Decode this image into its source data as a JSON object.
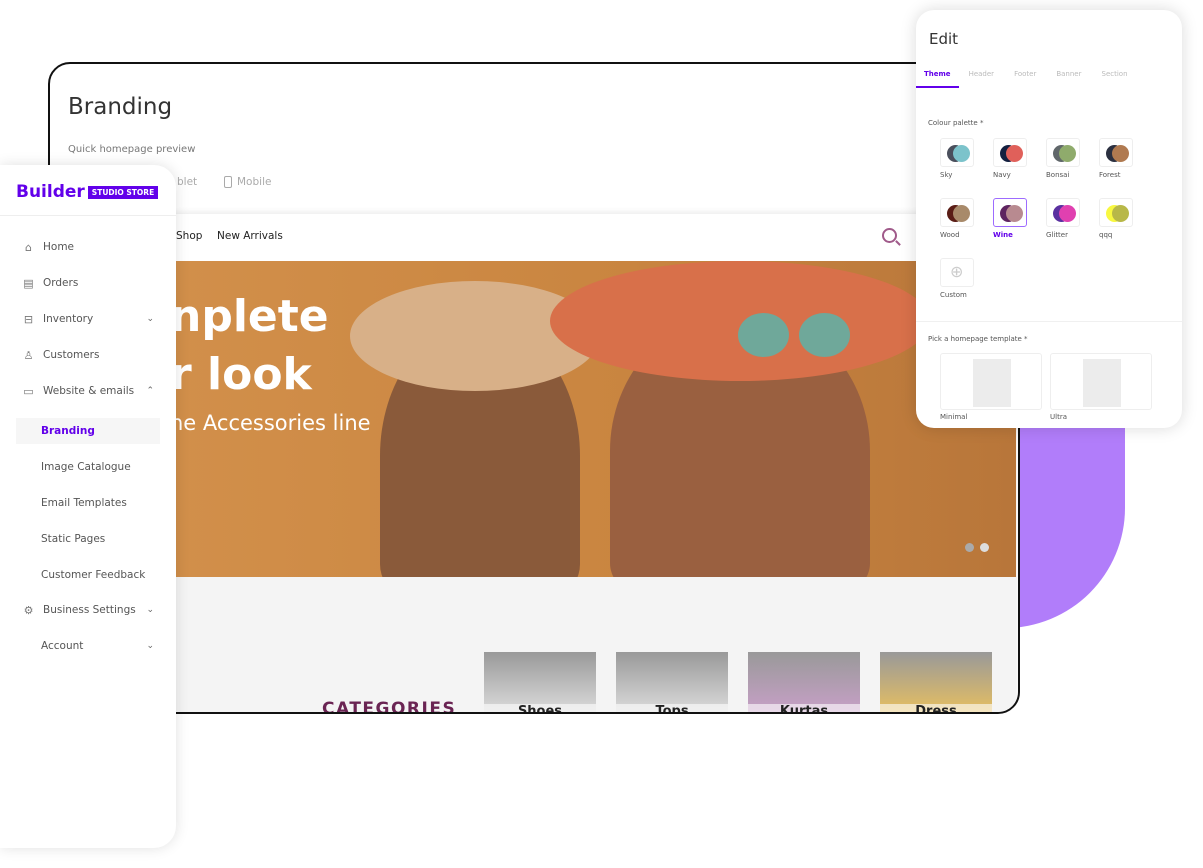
{
  "colors": {
    "accent": "#6200ea",
    "blob": "#b17dfa",
    "categories_title": "#6a2453"
  },
  "page": {
    "title": "Branding",
    "subtitle": "Quick homepage preview",
    "device_tabs": [
      "blet",
      "Mobile"
    ]
  },
  "preview": {
    "nav": [
      "Shop",
      "New Arrivals"
    ],
    "search_icon": "search-icon",
    "hero": {
      "line1": "nplete",
      "line2": "r look",
      "line3": "he Accessories line"
    },
    "categories_title": "CATEGORIES",
    "categories": [
      "Shoes",
      "Tops",
      "Kurtas",
      "Dress"
    ]
  },
  "sidebar": {
    "logo": "Builder",
    "logo_badge": "STUDIO STORE",
    "items": [
      {
        "label": "Home",
        "icon": "home-icon"
      },
      {
        "label": "Orders",
        "icon": "orders-icon"
      },
      {
        "label": "Inventory",
        "icon": "inventory-icon",
        "chevron": "⌄"
      },
      {
        "label": "Customers",
        "icon": "user-icon"
      },
      {
        "label": "Website & emails",
        "icon": "monitor-icon",
        "chevron": "⌃"
      },
      {
        "label": "Branding",
        "active": true
      },
      {
        "label": "Image Catalogue"
      },
      {
        "label": "Email Templates"
      },
      {
        "label": "Static Pages"
      },
      {
        "label": "Customer Feedback"
      },
      {
        "label": "Business Settings",
        "icon": "gear-icon",
        "chevron": "⌄"
      },
      {
        "label": "Account",
        "chevron": "⌄"
      }
    ]
  },
  "edit": {
    "title": "Edit",
    "tabs": [
      "Theme",
      "Header",
      "Footer",
      "Banner",
      "Section"
    ],
    "active_tab": "Theme",
    "palette_label": "Colour palette *",
    "palettes": [
      {
        "name": "Sky",
        "c1": "#4a4f5c",
        "c2": "#7cc3cb"
      },
      {
        "name": "Navy",
        "c1": "#132040",
        "c2": "#e0605a"
      },
      {
        "name": "Bonsai",
        "c1": "#60676a",
        "c2": "#8fab6c"
      },
      {
        "name": "Forest",
        "c1": "#2b3040",
        "c2": "#b07a50"
      },
      {
        "name": "Wood",
        "c1": "#5a1d16",
        "c2": "#a88a6a"
      },
      {
        "name": "Wine",
        "c1": "#5e2460",
        "c2": "#b88a90",
        "selected": true
      },
      {
        "name": "Glitter",
        "c1": "#5a30a0",
        "c2": "#e040b0"
      },
      {
        "name": "qqq",
        "c1": "#f8f840",
        "c2": "#b8b848"
      }
    ],
    "custom_label": "Custom",
    "template_label": "Pick a homepage template *",
    "templates": [
      "Minimal",
      "Ultra"
    ]
  }
}
